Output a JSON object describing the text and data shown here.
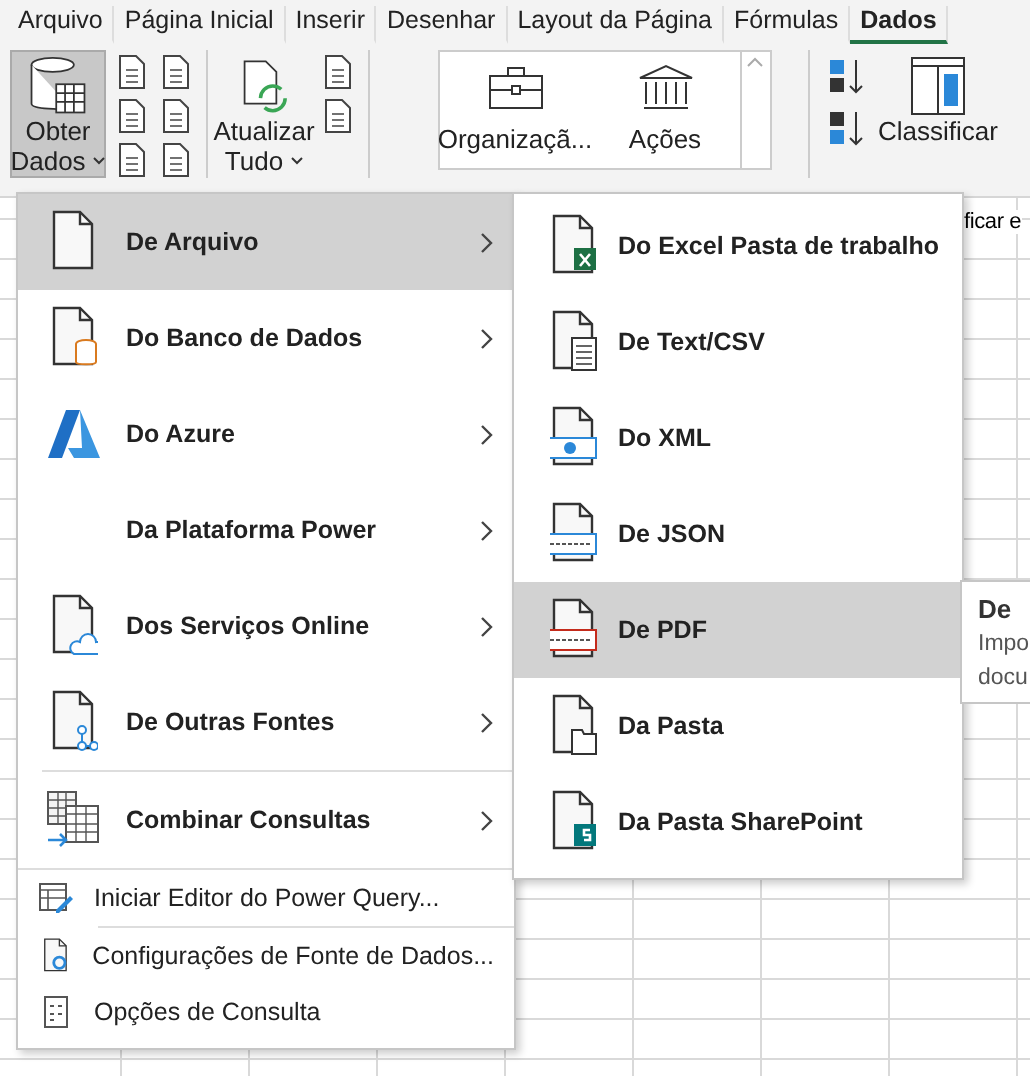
{
  "tabs": [
    {
      "label": "Arquivo",
      "selected": false
    },
    {
      "label": "Página Inicial",
      "selected": false
    },
    {
      "label": "Inserir",
      "selected": false
    },
    {
      "label": "Desenhar",
      "selected": false
    },
    {
      "label": "Layout da Página",
      "selected": false
    },
    {
      "label": "Fórmulas",
      "selected": false
    },
    {
      "label": "Dados",
      "selected": true
    }
  ],
  "ribbon": {
    "get_data": {
      "label_1": "Obter",
      "label_2": "Dados",
      "pressed": true
    },
    "refresh": {
      "label_1": "Atualizar",
      "label_2": "Tudo"
    },
    "data_types": [
      {
        "label": "Organizaçã..."
      },
      {
        "label": "Ações"
      }
    ],
    "sort": {
      "label": "Classificar"
    }
  },
  "sheet": {
    "fragment": "ficar e"
  },
  "menu": {
    "items": [
      {
        "kind": "large",
        "label": "De Arquivo",
        "selected": true
      },
      {
        "kind": "large",
        "label": "Do Banco de Dados",
        "selected": false
      },
      {
        "kind": "large",
        "label": "Do Azure",
        "selected": false
      },
      {
        "kind": "large",
        "label": "Da Plataforma Power",
        "selected": false
      },
      {
        "kind": "large",
        "label": "Dos Serviços Online",
        "selected": false
      },
      {
        "kind": "large",
        "label": "De Outras Fontes",
        "selected": false
      },
      {
        "kind": "large",
        "label": "Combinar Consultas",
        "selected": false
      },
      {
        "kind": "small",
        "label": "Iniciar Editor do Power Query...",
        "selected": false
      },
      {
        "kind": "small",
        "label": "Configurações de Fonte de Dados...",
        "selected": false
      },
      {
        "kind": "small",
        "label": "Opções de Consulta",
        "selected": false
      }
    ]
  },
  "submenu": {
    "items": [
      {
        "label": "Do Excel Pasta de trabalho",
        "selected": false
      },
      {
        "label": "De Text/CSV",
        "selected": false
      },
      {
        "label": "Do XML",
        "selected": false
      },
      {
        "label": "De JSON",
        "selected": false
      },
      {
        "label": "De PDF",
        "selected": true
      },
      {
        "label": "Da Pasta",
        "selected": false
      },
      {
        "label": "Da Pasta SharePoint",
        "selected": false
      }
    ]
  },
  "tooltip": {
    "title": "De",
    "line_1": "Impo",
    "line_2": "docu"
  }
}
